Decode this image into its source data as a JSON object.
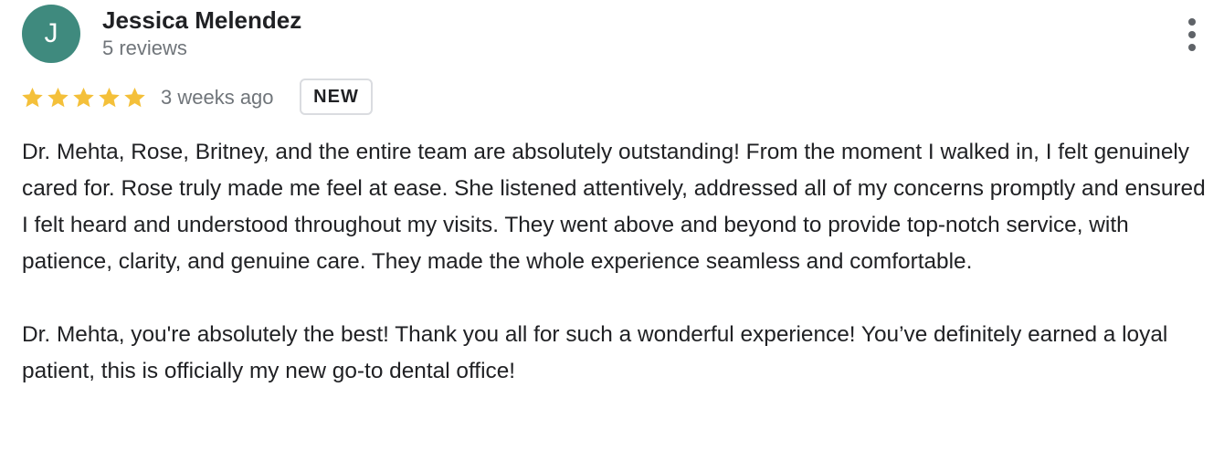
{
  "reviewer": {
    "initial": "J",
    "name": "Jessica Melendez",
    "review_count": "5 reviews",
    "avatar_color": "#3f8a7e"
  },
  "rating": {
    "stars": 5,
    "max": 5,
    "star_color": "#f4c03a"
  },
  "meta": {
    "time": "3 weeks ago",
    "badge": "NEW"
  },
  "menu_icon": "more-vertical-icon",
  "review": {
    "paragraphs": [
      "Dr. Mehta, Rose, Britney, and the entire team are absolutely outstanding! From the moment I walked in, I felt genuinely cared for. Rose truly made me feel at ease. She listened attentively, addressed all of my concerns promptly and ensured I felt heard and understood throughout my visits. They went above and beyond to provide top-notch service, with patience, clarity, and genuine care. They made the whole experience seamless and comfortable.",
      "Dr. Mehta, you're absolutely the best! Thank you all for such a wonderful experience! You’ve definitely earned a loyal patient, this is officially my new go-to dental office!"
    ]
  }
}
